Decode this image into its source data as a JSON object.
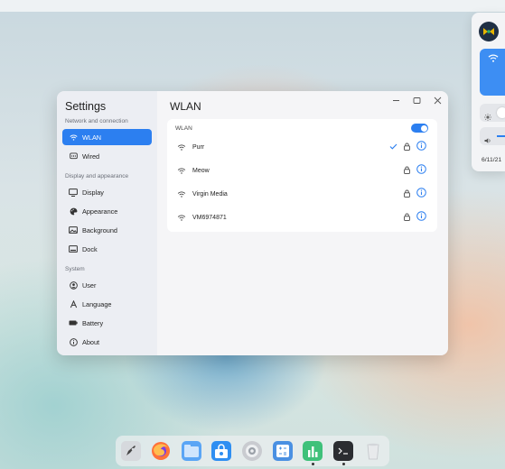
{
  "sidebar": {
    "title": "Settings",
    "sections": {
      "network": "Network and connection",
      "display": "Display and appearance",
      "system": "System"
    },
    "items": [
      {
        "label": "WLAN",
        "icon": "wifi-icon",
        "active": true
      },
      {
        "label": "Wired",
        "icon": "ethernet-icon"
      },
      {
        "label": "Display",
        "icon": "monitor-icon"
      },
      {
        "label": "Appearance",
        "icon": "palette-icon"
      },
      {
        "label": "Background",
        "icon": "image-icon"
      },
      {
        "label": "Dock",
        "icon": "dock-icon"
      },
      {
        "label": "User",
        "icon": "user-icon"
      },
      {
        "label": "Language",
        "icon": "language-icon"
      },
      {
        "label": "Battery",
        "icon": "battery-icon"
      },
      {
        "label": "About",
        "icon": "info-icon"
      }
    ]
  },
  "main": {
    "title": "WLAN",
    "wlan_label": "WLAN",
    "wlan_enabled": true,
    "networks": [
      {
        "ssid": "Purr",
        "connected": true,
        "secured": true
      },
      {
        "ssid": "Meow",
        "connected": false,
        "secured": true
      },
      {
        "ssid": "Virgin Media",
        "connected": false,
        "secured": true
      },
      {
        "ssid": "VM6974871",
        "connected": false,
        "secured": true
      }
    ]
  },
  "panel": {
    "date": "6/11/21"
  },
  "dock": {
    "apps": [
      "launcher-icon",
      "firefox-icon",
      "file-manager-icon",
      "app-store-icon",
      "settings-icon",
      "calculator-icon",
      "system-monitor-icon",
      "terminal-icon",
      "trash-icon"
    ]
  },
  "colors": {
    "accent": "#2c7ff0"
  }
}
